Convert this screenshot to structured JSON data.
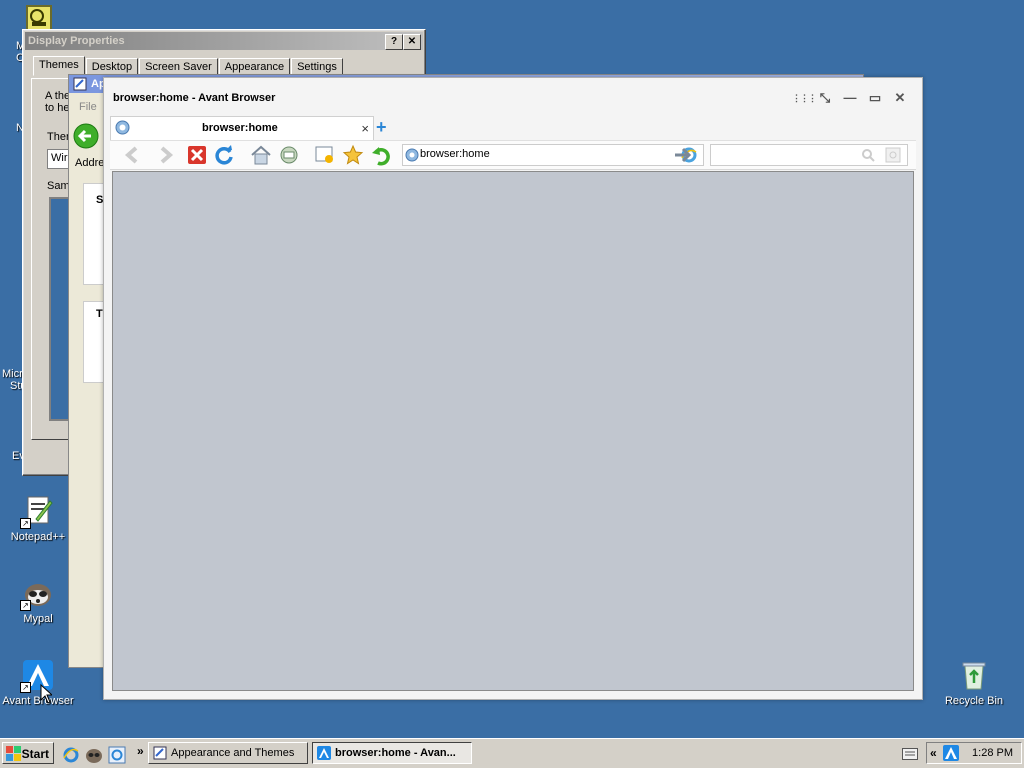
{
  "desktop": {
    "icons": [
      {
        "name": "notepadpp",
        "label": "Notepad++"
      },
      {
        "name": "mypal",
        "label": "Mypal"
      },
      {
        "name": "avant",
        "label": "Avant Browser"
      },
      {
        "name": "recycle",
        "label": "Recycle Bin"
      }
    ],
    "partial_labels": [
      "M",
      "C",
      "N",
      "Micro",
      "Stu",
      "Ev"
    ]
  },
  "display_properties": {
    "title": "Display Properties",
    "help_btn": "?",
    "close_btn": "✕",
    "tabs": [
      "Themes",
      "Desktop",
      "Screen Saver",
      "Appearance",
      "Settings"
    ],
    "text_a": "A the",
    "text_b": "to he",
    "text_theme": "Ther",
    "text_win": "Wir",
    "text_sample": "Sam"
  },
  "appearance_window": {
    "title": "Ap",
    "menu_file": "File",
    "address": "Addre",
    "side_s": "S",
    "side_t": "T"
  },
  "browser": {
    "title": "browser:home - Avant Browser",
    "tab_label": "browser:home",
    "tab_close": "×",
    "new_tab": "+",
    "address_value": "browser:home",
    "search_placeholder": "",
    "controls": {
      "grid": "⋮⋮⋮",
      "min": "—",
      "max": "▭",
      "close": "✕"
    }
  },
  "taskbar": {
    "start_label": "Start",
    "chevron": "»",
    "tasks": [
      {
        "label": "Appearance and Themes",
        "active": false
      },
      {
        "label": "browser:home - Avan...",
        "active": true
      }
    ],
    "tray_chevron": "«",
    "clock": "1:28 PM"
  },
  "colors": {
    "desktop": "#3a6ea5",
    "content_area": "#c1c6cf",
    "accent_blue": "#2b86d6"
  }
}
